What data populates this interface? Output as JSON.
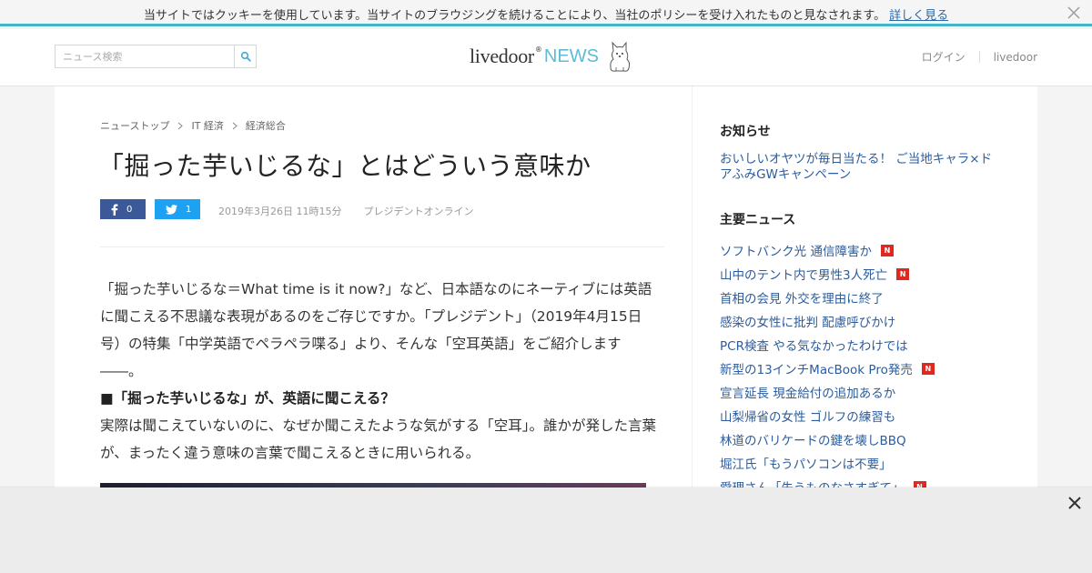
{
  "cookie_bar": {
    "message": "当サイトではクッキーを使用しています。当サイトのブラウジングを続けることにより、当社のポリシーを受け入れたものと見なされます。",
    "link": "詳しく見る"
  },
  "header": {
    "search_placeholder": "ニュース検索",
    "logo_main": "livedoor",
    "logo_mark": "®",
    "logo_news": "NEWS",
    "login": "ログイン",
    "livedoor_link": "livedoor"
  },
  "breadcrumb": [
    "ニューストップ",
    "IT 経済",
    "経済総合"
  ],
  "article": {
    "title": "「掘った芋いじるな」とはどういう意味か",
    "facebook_count": "0",
    "twitter_count": "1",
    "date": "2019年3月26日 11時15分",
    "source": "プレジデントオンライン",
    "paragraph1": "「掘った芋いじるな＝What time is it now?」など、日本語なのにネーティブには英語に聞こえる不思議な表現があるのをご存じですか。「プレジデント」（2019年4月15日号）の特集「中学英語でペラペラ喋る」より、そんな「空耳英語」をご紹介します――。",
    "subheading": "■「掘った芋いじるな」が、英語に聞こえる？",
    "paragraph2": "実際は聞こえていないのに、なぜか聞こえたような気がする「空耳」。誰かが発した言葉が、まったく違う意味の言葉で聞こえるときに用いられる。"
  },
  "sidebar": {
    "notice_heading": "お知らせ",
    "notice_text": "おいしいオヤツが毎日当たる！ ご当地キャラ×ドアふみGWキャンペーン",
    "news_heading": "主要ニュース",
    "new_badge": "N",
    "news": [
      {
        "text": "ソフトバンク光 通信障害か",
        "new": true
      },
      {
        "text": "山中のテント内で男性3人死亡",
        "new": true
      },
      {
        "text": "首相の会見 外交を理由に終了",
        "new": false
      },
      {
        "text": "感染の女性に批判 配慮呼びかけ",
        "new": false
      },
      {
        "text": "PCR検査 やる気なかったわけでは",
        "new": false
      },
      {
        "text": "新型の13インチMacBook Pro発売",
        "new": true
      },
      {
        "text": "宣言延長 現金給付の追加あるか",
        "new": false
      },
      {
        "text": "山梨帰省の女性 ゴルフの練習も",
        "new": false
      },
      {
        "text": "林道のバリケードの鍵を壊しBBQ",
        "new": false
      },
      {
        "text": "堀江氏「もうパソコンは不要」",
        "new": false
      },
      {
        "text": "愛理さん「失うものなさすぎて」",
        "new": true
      }
    ]
  },
  "colors": {
    "accent": "#44b4c9",
    "link": "#2c5c9c",
    "facebook": "#3b5998",
    "twitter": "#1da1f2",
    "new_badge": "#e0281f"
  }
}
